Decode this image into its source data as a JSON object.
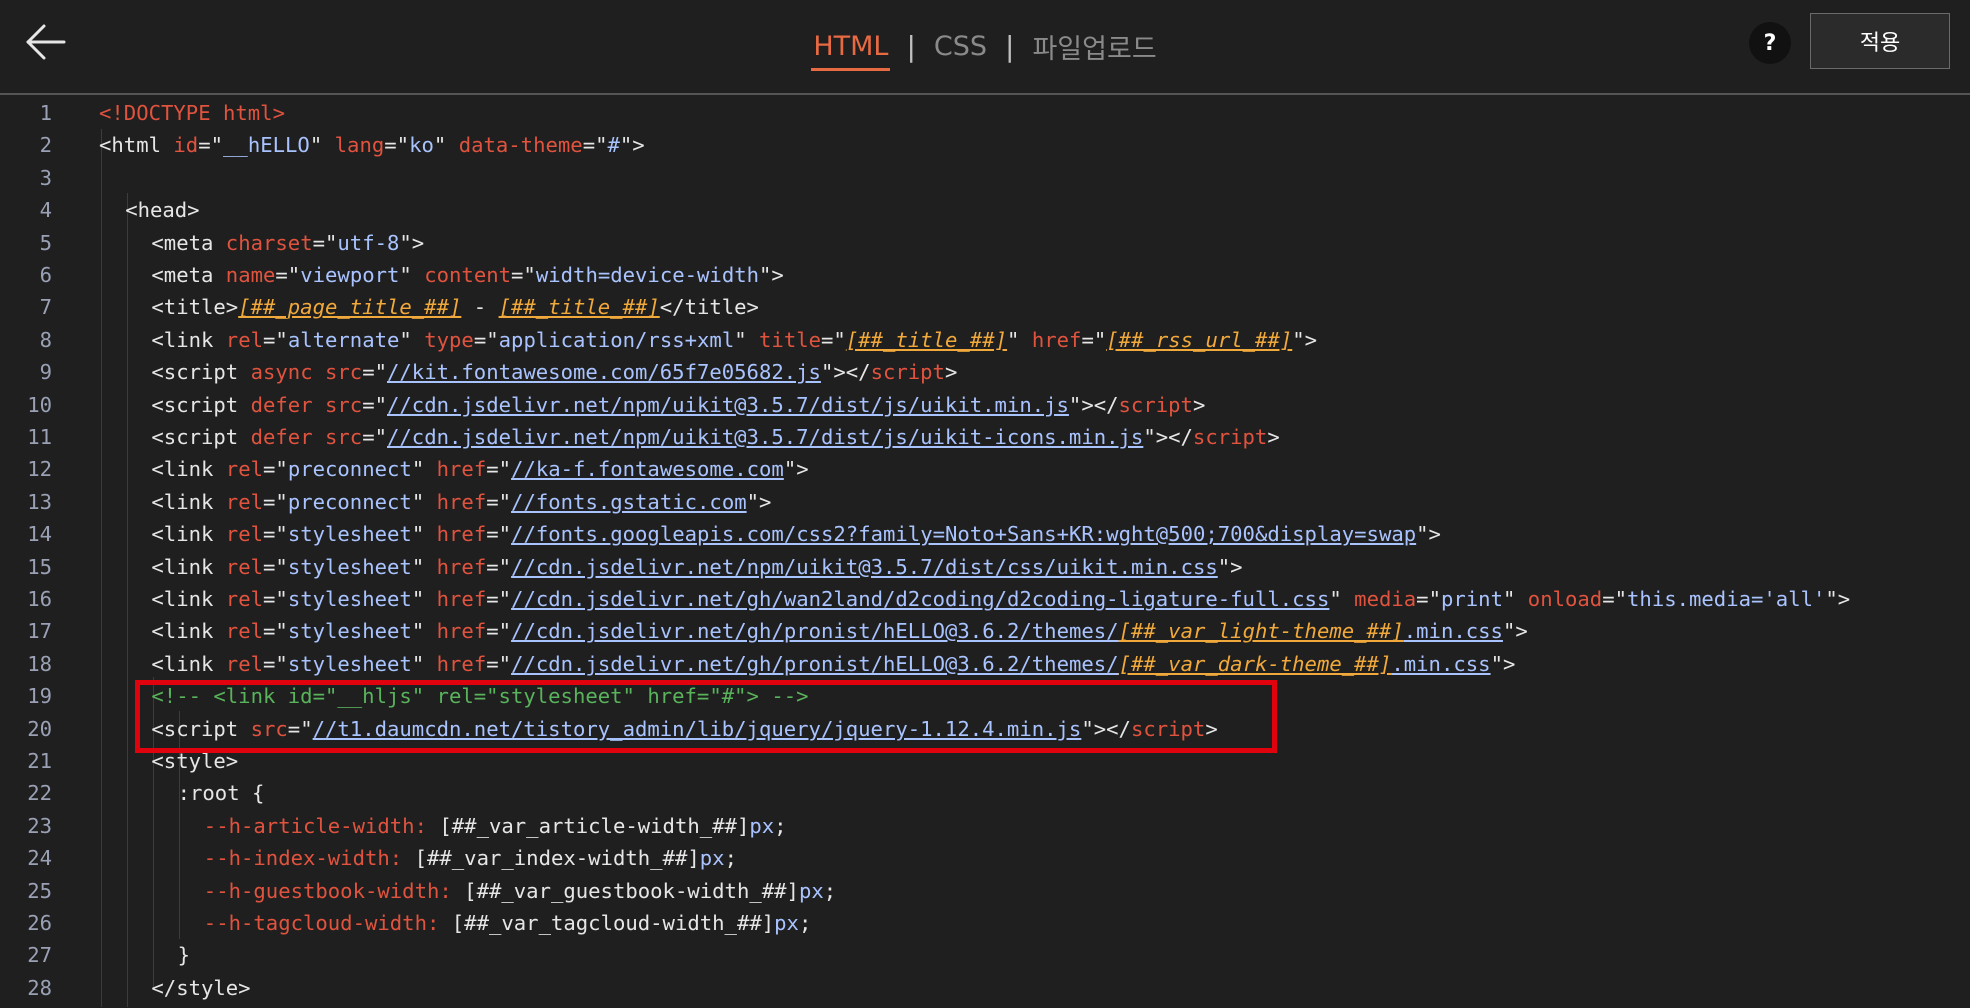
{
  "header": {
    "tabs": [
      "HTML",
      "CSS",
      "파일업로드"
    ],
    "separator": "|",
    "help_label": "?",
    "apply_label": "적용"
  },
  "code": {
    "line_numbers": [
      "1",
      "2",
      "3",
      "4",
      "5",
      "6",
      "7",
      "8",
      "9",
      "10",
      "11",
      "12",
      "13",
      "14",
      "15",
      "16",
      "17",
      "18",
      "19",
      "20",
      "21",
      "22",
      "23",
      "24",
      "25",
      "26",
      "27",
      "28"
    ],
    "lines": [
      [
        [
          "doc",
          "<!DOCTYPE html>"
        ]
      ],
      [
        [
          "t",
          "<html "
        ],
        [
          "a",
          "id"
        ],
        [
          "t",
          "=\""
        ],
        [
          "s",
          "__hELLO"
        ],
        [
          "t",
          "\" "
        ],
        [
          "a",
          "lang"
        ],
        [
          "t",
          "=\""
        ],
        [
          "s",
          "ko"
        ],
        [
          "t",
          "\" "
        ],
        [
          "a",
          "data-theme"
        ],
        [
          "t",
          "=\""
        ],
        [
          "s",
          "#"
        ],
        [
          "t",
          "\">"
        ]
      ],
      [],
      [
        [
          "t",
          "<head>"
        ]
      ],
      [
        [
          "t",
          "<meta "
        ],
        [
          "a",
          "charset"
        ],
        [
          "t",
          "=\""
        ],
        [
          "s",
          "utf-8"
        ],
        [
          "t",
          "\">"
        ]
      ],
      [
        [
          "t",
          "<meta "
        ],
        [
          "a",
          "name"
        ],
        [
          "t",
          "=\""
        ],
        [
          "s",
          "viewport"
        ],
        [
          "t",
          "\" "
        ],
        [
          "a",
          "content"
        ],
        [
          "t",
          "=\""
        ],
        [
          "s",
          "width=device-width"
        ],
        [
          "t",
          "\">"
        ]
      ],
      [
        [
          "t",
          "<title>"
        ],
        [
          "v",
          "[##_page_title_##]"
        ],
        [
          "t",
          " - "
        ],
        [
          "v",
          "[##_title_##]"
        ],
        [
          "t",
          "</title>"
        ]
      ],
      [
        [
          "t",
          "<link "
        ],
        [
          "a",
          "rel"
        ],
        [
          "t",
          "=\""
        ],
        [
          "s",
          "alternate"
        ],
        [
          "t",
          "\" "
        ],
        [
          "a",
          "type"
        ],
        [
          "t",
          "=\""
        ],
        [
          "s",
          "application/rss+xml"
        ],
        [
          "t",
          "\" "
        ],
        [
          "a",
          "title"
        ],
        [
          "t",
          "=\""
        ],
        [
          "v",
          "[##_title_##]"
        ],
        [
          "t",
          "\" "
        ],
        [
          "a",
          "href"
        ],
        [
          "t",
          "=\""
        ],
        [
          "v",
          "[##_rss_url_##]"
        ],
        [
          "t",
          "\">"
        ]
      ],
      [
        [
          "t",
          "<script "
        ],
        [
          "a",
          "async src"
        ],
        [
          "t",
          "=\""
        ],
        [
          "u",
          "//kit.fontawesome.com/65f7e05682.js"
        ],
        [
          "t",
          "\"></"
        ],
        [
          "a",
          "script"
        ],
        [
          "t",
          ">"
        ]
      ],
      [
        [
          "t",
          "<script "
        ],
        [
          "a",
          "defer src"
        ],
        [
          "t",
          "=\""
        ],
        [
          "u",
          "//cdn.jsdelivr.net/npm/uikit@3.5.7/dist/js/uikit.min.js"
        ],
        [
          "t",
          "\"></"
        ],
        [
          "a",
          "script"
        ],
        [
          "t",
          ">"
        ]
      ],
      [
        [
          "t",
          "<script "
        ],
        [
          "a",
          "defer src"
        ],
        [
          "t",
          "=\""
        ],
        [
          "u",
          "//cdn.jsdelivr.net/npm/uikit@3.5.7/dist/js/uikit-icons.min.js"
        ],
        [
          "t",
          "\"></"
        ],
        [
          "a",
          "script"
        ],
        [
          "t",
          ">"
        ]
      ],
      [
        [
          "t",
          "<link "
        ],
        [
          "a",
          "rel"
        ],
        [
          "t",
          "=\""
        ],
        [
          "s",
          "preconnect"
        ],
        [
          "t",
          "\" "
        ],
        [
          "a",
          "href"
        ],
        [
          "t",
          "=\""
        ],
        [
          "u",
          "//ka-f.fontawesome.com"
        ],
        [
          "t",
          "\">"
        ]
      ],
      [
        [
          "t",
          "<link "
        ],
        [
          "a",
          "rel"
        ],
        [
          "t",
          "=\""
        ],
        [
          "s",
          "preconnect"
        ],
        [
          "t",
          "\" "
        ],
        [
          "a",
          "href"
        ],
        [
          "t",
          "=\""
        ],
        [
          "u",
          "//fonts.gstatic.com"
        ],
        [
          "t",
          "\">"
        ]
      ],
      [
        [
          "t",
          "<link "
        ],
        [
          "a",
          "rel"
        ],
        [
          "t",
          "=\""
        ],
        [
          "s",
          "stylesheet"
        ],
        [
          "t",
          "\" "
        ],
        [
          "a",
          "href"
        ],
        [
          "t",
          "=\""
        ],
        [
          "u",
          "//fonts.googleapis.com/css2?family=Noto+Sans+KR:wght@500;700&display=swap"
        ],
        [
          "t",
          "\">"
        ]
      ],
      [
        [
          "t",
          "<link "
        ],
        [
          "a",
          "rel"
        ],
        [
          "t",
          "=\""
        ],
        [
          "s",
          "stylesheet"
        ],
        [
          "t",
          "\" "
        ],
        [
          "a",
          "href"
        ],
        [
          "t",
          "=\""
        ],
        [
          "u",
          "//cdn.jsdelivr.net/npm/uikit@3.5.7/dist/css/uikit.min.css"
        ],
        [
          "t",
          "\">"
        ]
      ],
      [
        [
          "t",
          "<link "
        ],
        [
          "a",
          "rel"
        ],
        [
          "t",
          "=\""
        ],
        [
          "s",
          "stylesheet"
        ],
        [
          "t",
          "\" "
        ],
        [
          "a",
          "href"
        ],
        [
          "t",
          "=\""
        ],
        [
          "u",
          "//cdn.jsdelivr.net/gh/wan2land/d2coding/d2coding-ligature-full.css"
        ],
        [
          "t",
          "\" "
        ],
        [
          "a",
          "media"
        ],
        [
          "t",
          "=\""
        ],
        [
          "s",
          "print"
        ],
        [
          "t",
          "\" "
        ],
        [
          "a",
          "onload"
        ],
        [
          "t",
          "=\""
        ],
        [
          "s",
          "this.media='all'"
        ],
        [
          "t",
          "\">"
        ]
      ],
      [
        [
          "t",
          "<link "
        ],
        [
          "a",
          "rel"
        ],
        [
          "t",
          "=\""
        ],
        [
          "s",
          "stylesheet"
        ],
        [
          "t",
          "\" "
        ],
        [
          "a",
          "href"
        ],
        [
          "t",
          "=\""
        ],
        [
          "u",
          "//cdn.jsdelivr.net/gh/pronist/hELLO@3.6.2/themes/"
        ],
        [
          "v",
          "[##_var_light-theme_##]"
        ],
        [
          "u",
          ".min.css"
        ],
        [
          "t",
          "\">"
        ]
      ],
      [
        [
          "t",
          "<link "
        ],
        [
          "a",
          "rel"
        ],
        [
          "t",
          "=\""
        ],
        [
          "s",
          "stylesheet"
        ],
        [
          "t",
          "\" "
        ],
        [
          "a",
          "href"
        ],
        [
          "t",
          "=\""
        ],
        [
          "u",
          "//cdn.jsdelivr.net/gh/pronist/hELLO@3.6.2/themes/"
        ],
        [
          "v",
          "[##_var_dark-theme_##]"
        ],
        [
          "u",
          ".min.css"
        ],
        [
          "t",
          "\">"
        ]
      ],
      [
        [
          "c",
          "<!-- <link id=\"__hljs\" rel=\"stylesheet\" href=\"#\"> -->"
        ]
      ],
      [
        [
          "t",
          "<script "
        ],
        [
          "a",
          "src"
        ],
        [
          "t",
          "=\""
        ],
        [
          "u",
          "//t1.daumcdn.net/tistory_admin/lib/jquery/jquery-1.12.4.min.js"
        ],
        [
          "t",
          "\"></"
        ],
        [
          "a",
          "script"
        ],
        [
          "t",
          ">"
        ]
      ],
      [
        [
          "t",
          "<style>"
        ]
      ],
      [
        [
          "t",
          ":root {"
        ]
      ],
      [
        [
          "r",
          "--h-article-width: "
        ],
        [
          "t",
          "[##_var_article-width_##]"
        ],
        [
          "s",
          "px"
        ],
        [
          "t",
          ";"
        ]
      ],
      [
        [
          "r",
          "--h-index-width: "
        ],
        [
          "t",
          "[##_var_index-width_##]"
        ],
        [
          "s",
          "px"
        ],
        [
          "t",
          ";"
        ]
      ],
      [
        [
          "r",
          "--h-guestbook-width: "
        ],
        [
          "t",
          "[##_var_guestbook-width_##]"
        ],
        [
          "s",
          "px"
        ],
        [
          "t",
          ";"
        ]
      ],
      [
        [
          "r",
          "--h-tagcloud-width: "
        ],
        [
          "t",
          "[##_var_tagcloud-width_##]"
        ],
        [
          "s",
          "px"
        ],
        [
          "t",
          ";"
        ]
      ],
      [
        [
          "t",
          "}"
        ]
      ],
      [
        [
          "t",
          "</style>"
        ]
      ]
    ]
  },
  "colors": {
    "accent": "#e86a43",
    "highlight_border": "#e0020c"
  }
}
